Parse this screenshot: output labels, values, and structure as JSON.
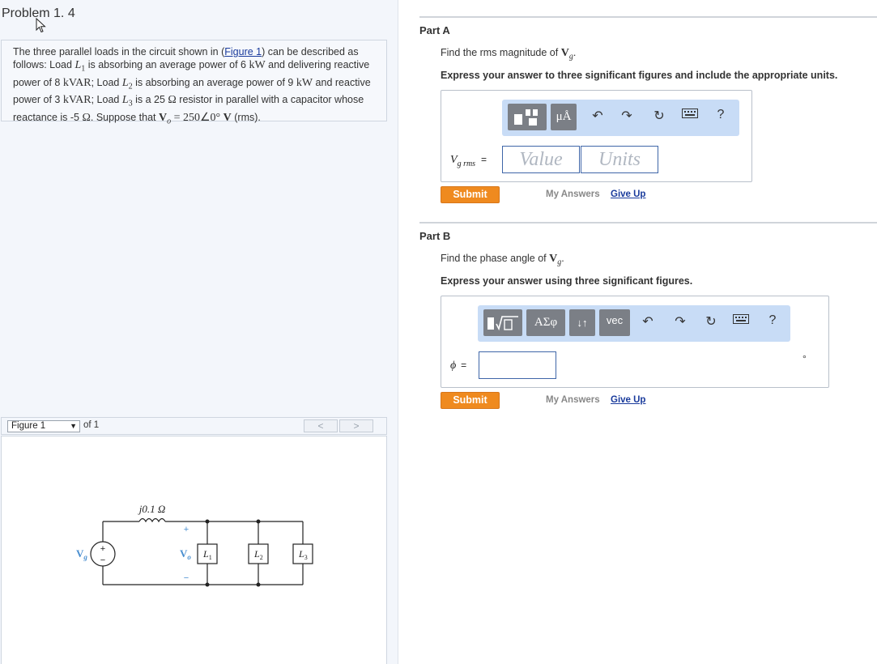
{
  "problem": {
    "title": "Problem 1. 4",
    "text_parts": {
      "p1": "The three parallel loads in the circuit shown in (",
      "fig_link": "Figure 1",
      "p2": ") can be described as follows: Load ",
      "L1": "L",
      "L1_sub": "1",
      "p3": " is absorbing an average power of 6 ",
      "kW1": "kW",
      "p4": " and delivering reactive power of 8 ",
      "kVAR1": "kVAR",
      "p5": "; Load ",
      "L2": "L",
      "L2_sub": "2",
      "p6": " is absorbing an average power of 9 ",
      "kW2": "kW",
      "p7": " and reactive power of 3 ",
      "kVAR2": "kVAR",
      "p8": "; Load ",
      "L3": "L",
      "L3_sub": "3",
      "p9": " is a 25 ",
      "ohm1": "Ω",
      "p10": " resistor in parallel with a capacitor whose reactance is -5 ",
      "ohm2": "Ω",
      "p11": ". Suppose that ",
      "Vo": "V",
      "Vo_sub": "o",
      "eq": " = 250∠0° ",
      "V": "V",
      "p12": " (rms)."
    }
  },
  "figure_nav": {
    "select_value": "Figure 1",
    "of_label": "of 1",
    "prev": "<",
    "next": ">"
  },
  "circuit": {
    "impedance_label": "j0.1 Ω",
    "vg_label": "V",
    "vg_sub": "g",
    "vo_label": "V",
    "vo_sub": "o",
    "plus": "+",
    "minus": "−",
    "src_plus": "+",
    "src_minus": "−",
    "load1": "L",
    "load1_sub": "1",
    "load2": "L",
    "load2_sub": "2",
    "load3": "L",
    "load3_sub": "3"
  },
  "partA": {
    "title": "Part A",
    "prompt_pre": "Find the rms magnitude of ",
    "prompt_var": "V",
    "prompt_sub": "g",
    "prompt_post": ".",
    "instruction": "Express your answer to three significant figures and include the appropriate units.",
    "toolbar_unit_btn": "μÅ",
    "var_label": "V",
    "var_sub": "g rms",
    "equals": "=",
    "value_placeholder": "Value",
    "units_placeholder": "Units",
    "submit": "Submit",
    "my_answers": "My Answers",
    "give_up": "Give Up",
    "help": "?"
  },
  "partB": {
    "title": "Part B",
    "prompt_pre": "Find the phase angle of ",
    "prompt_var": "V",
    "prompt_sub": "g",
    "prompt_post": ".",
    "instruction": "Express your answer using three significant figures.",
    "toolbar_greek_btn": "ΑΣφ",
    "toolbar_sort_btn": "↓↑",
    "toolbar_vec_btn": "vec",
    "var_label": "ϕ",
    "equals": "=",
    "unit_symbol": "°",
    "submit": "Submit",
    "my_answers": "My Answers",
    "give_up": "Give Up",
    "help": "?"
  },
  "colors": {
    "submit": "#ef8a1f",
    "link": "#1a3b9c",
    "toolbar_bg": "#c8dcf6",
    "circuit_label": "#4a8fd0"
  }
}
